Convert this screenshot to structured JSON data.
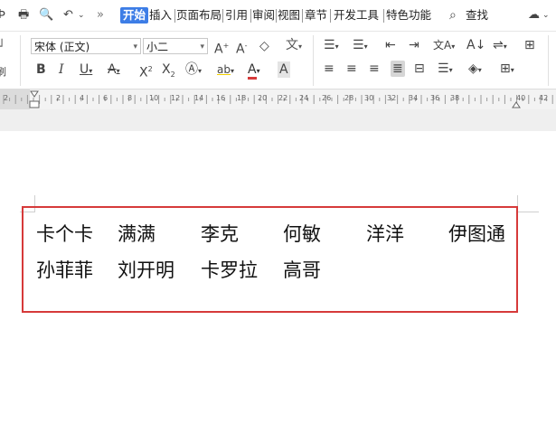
{
  "menubar": {
    "tabs": [
      {
        "label": "开始",
        "active": true
      },
      {
        "label": "插入"
      },
      {
        "label": "页面布局"
      },
      {
        "label": "引用"
      },
      {
        "label": "审阅"
      },
      {
        "label": "视图"
      },
      {
        "label": "章节"
      },
      {
        "label": "开发工具"
      },
      {
        "label": "特色功能"
      }
    ],
    "search_label": "查找",
    "overflow": "»"
  },
  "ribbon": {
    "font_name": "宋体 (正文)",
    "font_size": "小二",
    "left_label": "刷"
  },
  "ruler": {
    "numbers": [
      "2",
      "2",
      "4",
      "6",
      "8",
      "10",
      "12",
      "14",
      "16",
      "18",
      "20",
      "22",
      "24",
      "26",
      "28",
      "30",
      "32",
      "34",
      "36",
      "38",
      "40",
      "42"
    ]
  },
  "document": {
    "names_row1": [
      "卡个卡",
      "满满",
      "李克",
      "何敏",
      "洋洋",
      "伊图通"
    ],
    "names_row2": [
      "孙菲菲",
      "刘开明",
      "卡罗拉",
      "高哥"
    ]
  },
  "colors": {
    "accent": "#3d7de6",
    "highlight_border": "#d63a3a",
    "font_color_red": "#d63a3a"
  }
}
